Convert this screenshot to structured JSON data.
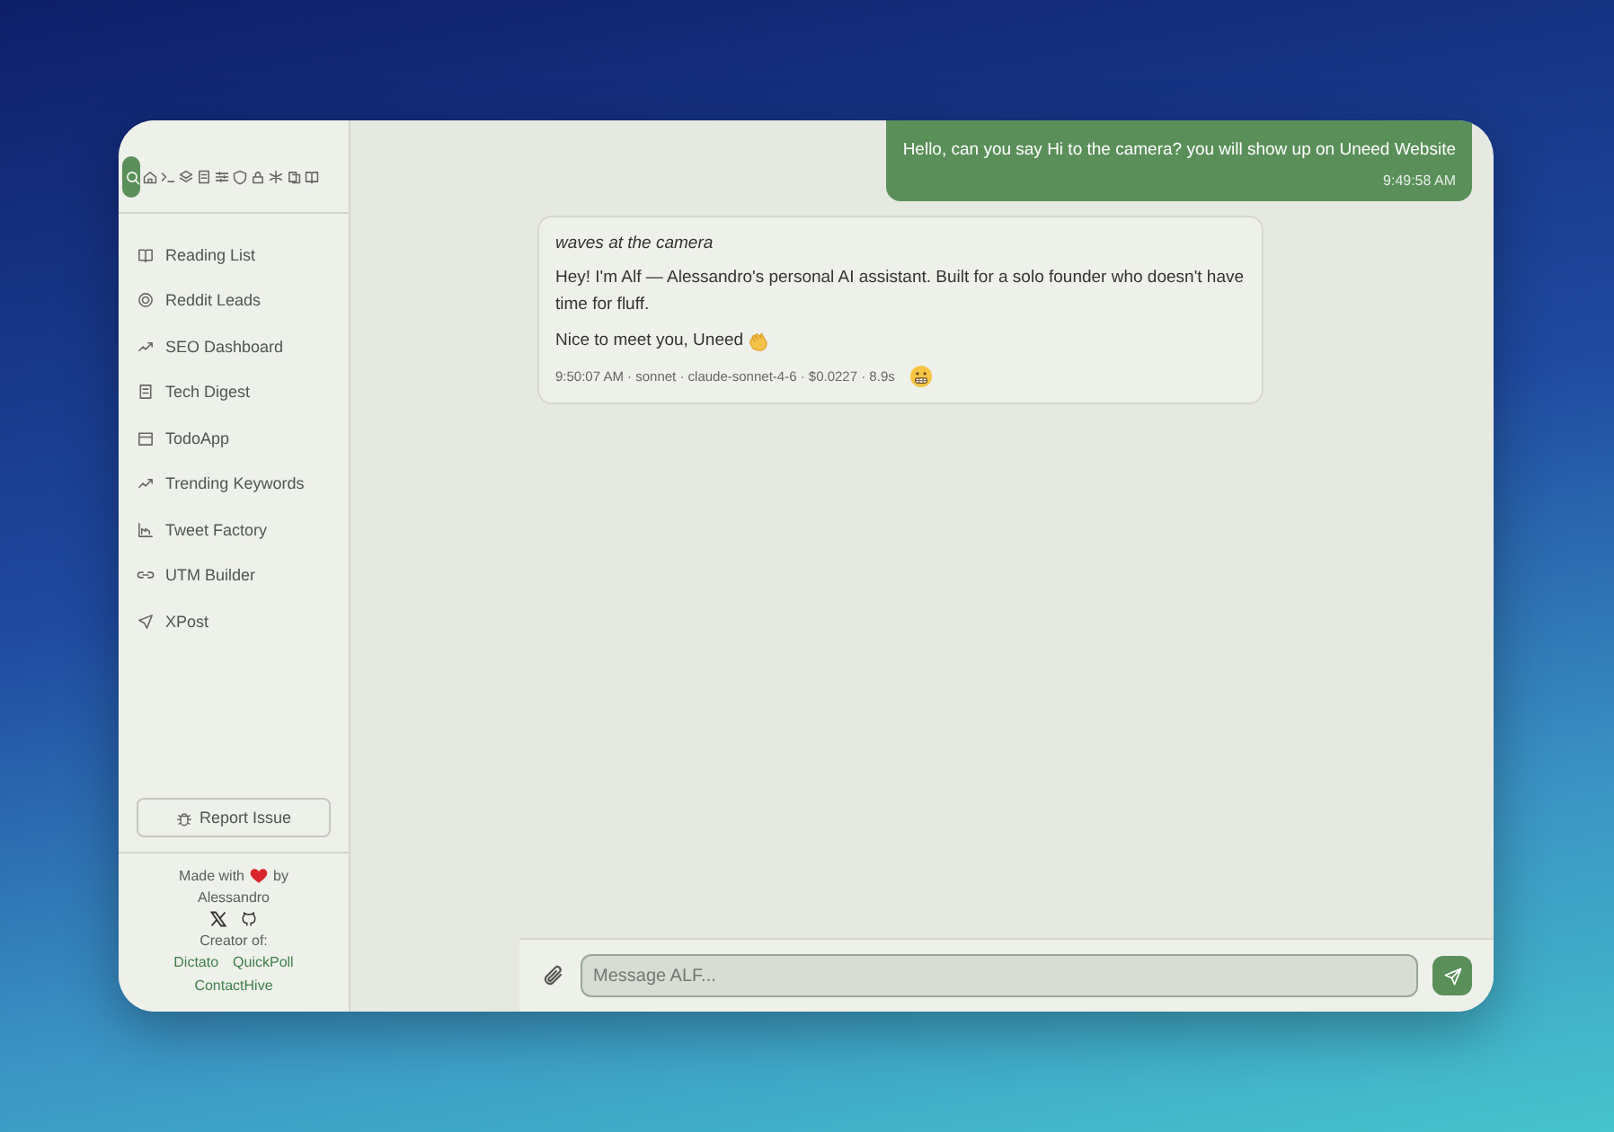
{
  "toolbar": {
    "tabs": [
      {
        "selected": true
      },
      {
        "selected": false
      },
      {
        "selected": false
      },
      {
        "selected": false
      },
      {
        "selected": false
      },
      {
        "selected": false
      },
      {
        "selected": false
      },
      {
        "selected": false
      },
      {
        "selected": false
      },
      {
        "selected": false
      },
      {
        "selected": false
      }
    ]
  },
  "sidebar": {
    "items": [
      {
        "label": "Reading List"
      },
      {
        "label": "Reddit Leads"
      },
      {
        "label": "SEO Dashboard"
      },
      {
        "label": "Tech Digest"
      },
      {
        "label": "TodoApp"
      },
      {
        "label": "Trending Keywords"
      },
      {
        "label": "Tweet Factory"
      },
      {
        "label": "UTM Builder"
      },
      {
        "label": "XPost"
      }
    ],
    "report_button": "Report Issue",
    "footer": {
      "made_with": "Made with",
      "by": "by",
      "author": "Alessandro",
      "creator_of": "Creator of:",
      "links": [
        "Dictato",
        "QuickPoll",
        "ContactHive"
      ]
    }
  },
  "messages": [
    {
      "kind": "user",
      "text": "Hello, can you say Hi to the camera? you will show up on Uneed Website",
      "time": "9:49:58 AM"
    },
    {
      "kind": "assistant",
      "action": "waves at the camera",
      "paragraphs": [
        "Hey! I'm Alf — Alessandro's personal AI assistant. Built for a solo founder who doesn't have time for fluff.",
        "Nice to meet you, Uneed"
      ],
      "meta": "9:50:07 AM · sonnet · claude-sonnet-4-6 · $0.0227 · 8.9s"
    }
  ],
  "composer": {
    "placeholder": "Message ALF..."
  }
}
